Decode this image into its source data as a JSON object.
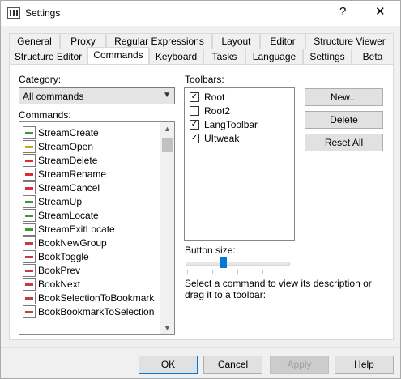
{
  "window": {
    "title": "Settings",
    "help_glyph": "?",
    "close_glyph": "✕"
  },
  "tabs": {
    "row1": [
      "General",
      "Proxy",
      "Regular Expressions",
      "Layout",
      "Editor",
      "Structure Viewer"
    ],
    "row2": [
      "Structure Editor",
      "Commands",
      "Keyboard",
      "Tasks",
      "Language",
      "Settings",
      "Beta"
    ],
    "active": "Commands"
  },
  "category": {
    "label": "Category:",
    "value": "All commands"
  },
  "commands": {
    "label": "Commands:",
    "items": [
      {
        "label": "StreamCreate",
        "icon": "stream-create-icon",
        "color": "#3a9a3a"
      },
      {
        "label": "StreamOpen",
        "icon": "stream-open-icon",
        "color": "#d4a017"
      },
      {
        "label": "StreamDelete",
        "icon": "stream-delete-icon",
        "color": "#d83030"
      },
      {
        "label": "StreamRename",
        "icon": "stream-rename-icon",
        "color": "#d83030"
      },
      {
        "label": "StreamCancel",
        "icon": "stream-cancel-icon",
        "color": "#d83030"
      },
      {
        "label": "StreamUp",
        "icon": "stream-up-icon",
        "color": "#3a9a3a"
      },
      {
        "label": "StreamLocate",
        "icon": "stream-locate-icon",
        "color": "#3a9a3a"
      },
      {
        "label": "StreamExitLocate",
        "icon": "stream-exit-locate-icon",
        "color": "#3a9a3a"
      },
      {
        "label": "BookNewGroup",
        "icon": "book-new-group-icon",
        "color": "#c04040"
      },
      {
        "label": "BookToggle",
        "icon": "book-toggle-icon",
        "color": "#c04040"
      },
      {
        "label": "BookPrev",
        "icon": "book-prev-icon",
        "color": "#c04040"
      },
      {
        "label": "BookNext",
        "icon": "book-next-icon",
        "color": "#c04040"
      },
      {
        "label": "BookSelectionToBookmark",
        "icon": "book-selection-icon",
        "color": "#c04040"
      },
      {
        "label": "BookBookmarkToSelection",
        "icon": "book-bookmark-icon",
        "color": "#c04040"
      }
    ]
  },
  "toolbars": {
    "label": "Toolbars:",
    "items": [
      {
        "label": "Root",
        "checked": true
      },
      {
        "label": "Root2",
        "checked": false
      },
      {
        "label": "LangToolbar",
        "checked": true
      },
      {
        "label": "UItweak",
        "checked": true
      }
    ]
  },
  "buttons": {
    "new": "New...",
    "delete": "Delete",
    "reset": "Reset All"
  },
  "button_size": {
    "label": "Button size:",
    "value_fraction": 0.38
  },
  "help_text": "Select a command to view its description or drag it to a toolbar:",
  "footer": {
    "ok": "OK",
    "cancel": "Cancel",
    "apply": "Apply",
    "help": "Help"
  }
}
